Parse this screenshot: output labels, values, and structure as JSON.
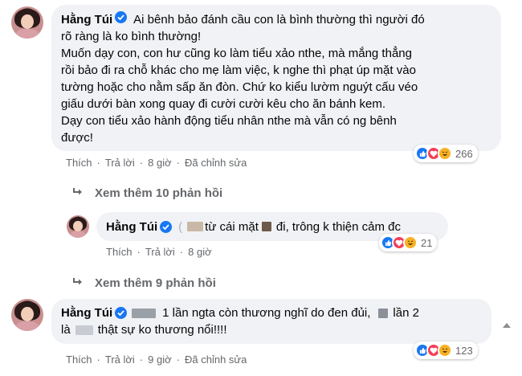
{
  "comment1": {
    "author": "Hằng Túi",
    "lines": [
      "Ai bênh bảo đánh cầu con là bình thường thì người đó",
      "rõ ràng là ko bình thường!",
      "Muốn dạy con, con hư cũng ko làm tiểu xảo nthe, mà mắng thẳng",
      "rồi bảo đi ra chỗ khác cho mẹ làm việc, k nghe thì phạt úp mặt vào",
      "tường hoặc cho nằm sấp ăn đòn. Chứ ko kiểu lườm nguýt cấu véo",
      "giấu dưới bàn xong quay đi cười cười kêu cho ăn bánh kem.",
      "Dạy con tiểu xảo hành động tiểu nhân nthe mà vẫn có ng bênh",
      "được!"
    ],
    "reactions_count": "266",
    "actions": {
      "like": "Thích",
      "reply": "Trả lời",
      "time": "8 giờ",
      "edited": "Đã chỉnh sửa"
    }
  },
  "more_replies_1": "Xem thêm 10 phản hồi",
  "reply1": {
    "author": "Hằng Túi",
    "text_a": "từ cái mặt",
    "text_b": "đi, trông k thiện cảm đc",
    "reactions_count": "21",
    "actions": {
      "like": "Thích",
      "reply": "Trả lời",
      "time": "8 giờ"
    }
  },
  "more_replies_2": "Xem thêm 9 phản hồi",
  "comment2": {
    "author": "Hằng Túi",
    "text_a": "1 lần ngta còn thương nghĩ do đen đủi,",
    "text_b": "lần 2",
    "text_c": "là",
    "text_d": "thật sự ko thương nổi!!!!",
    "reactions_count": "123",
    "actions": {
      "like": "Thích",
      "reply": "Trả lời",
      "time": "9 giờ",
      "edited": "Đã chỉnh sửa"
    }
  },
  "colors": {
    "verified": "#1877f2",
    "bubble": "#f0f2f5",
    "meta": "#65676b",
    "like": "#1877f2",
    "love": "#f33e58",
    "haha": "#f7b125"
  },
  "icons": [
    "verified-badge-icon",
    "like-reaction-icon",
    "love-reaction-icon",
    "haha-reaction-icon",
    "reply-arrow-icon",
    "scroll-up-icon"
  ]
}
